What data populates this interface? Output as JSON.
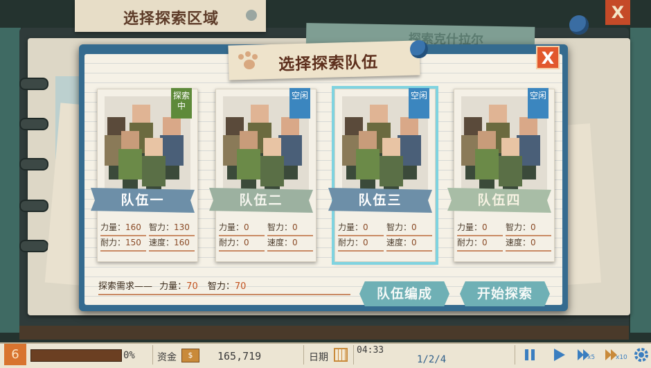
{
  "background": {
    "title": "选择探索区域",
    "green_card_text": "探索克什拉尔",
    "close_label": "X"
  },
  "dialog": {
    "title": "选择探索队伍",
    "close_label": "X"
  },
  "teams": [
    {
      "name": "队伍一",
      "status": "探索中",
      "strength_label": "力量：",
      "strength": "160",
      "intellect_label": "智力：",
      "intellect": "130",
      "endurance_label": "耐力：",
      "endurance": "150",
      "speed_label": "速度：",
      "speed": "160",
      "selected": false
    },
    {
      "name": "队伍二",
      "status": "空闲",
      "strength_label": "力量：",
      "strength": "0",
      "intellect_label": "智力：",
      "intellect": "0",
      "endurance_label": "耐力：",
      "endurance": "0",
      "speed_label": "速度：",
      "speed": "0",
      "selected": false
    },
    {
      "name": "队伍三",
      "status": "空闲",
      "strength_label": "力量：",
      "strength": "0",
      "intellect_label": "智力：",
      "intellect": "0",
      "endurance_label": "耐力：",
      "endurance": "0",
      "speed_label": "速度：",
      "speed": "0",
      "selected": true
    },
    {
      "name": "队伍四",
      "status": "空闲",
      "strength_label": "力量：",
      "strength": "0",
      "intellect_label": "智力：",
      "intellect": "0",
      "endurance_label": "耐力：",
      "endurance": "0",
      "speed_label": "速度：",
      "speed": "0",
      "selected": false
    }
  ],
  "requirement": {
    "label": "探索需求——",
    "strength_label": "力量：",
    "strength": "70",
    "intellect_label": "智力：",
    "intellect": "70"
  },
  "buttons": {
    "form_team": "队伍编成",
    "start_explore": "开始探索"
  },
  "status_bar": {
    "level": "6",
    "progress_percent": "0%",
    "progress_fraction": 0,
    "funds_label": "资金",
    "funds_icon_text": "$",
    "funds": "165,719",
    "date_label": "日期",
    "time": "04:33",
    "date": "1/2/4",
    "speed_x5": "x5",
    "speed_x10": "x10"
  },
  "icons": [
    "pause-icon",
    "play-icon",
    "fast-forward-x5-icon",
    "fast-forward-x10-icon",
    "gear-icon",
    "calendar-icon",
    "money-icon",
    "paw-icon",
    "pin-icon"
  ],
  "colors": {
    "accent_orange": "#e2582c",
    "dialog_blue": "#356b8f",
    "button_teal": "#6fb0b5",
    "busy_green": "#5e8a3a",
    "idle_blue": "#3b86bf"
  }
}
